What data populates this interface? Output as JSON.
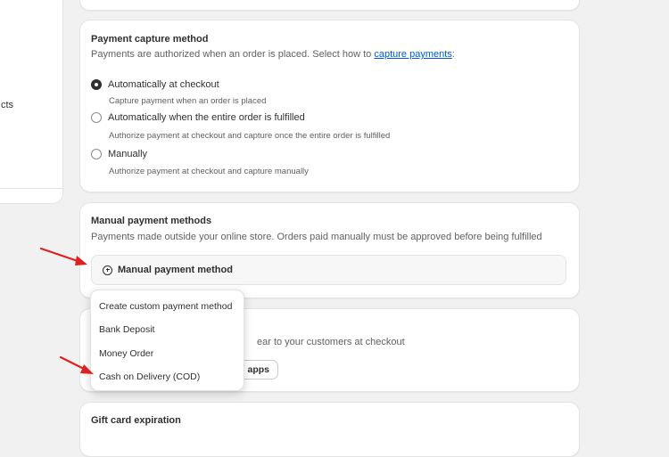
{
  "sidebar_fragment": {
    "text": "cts"
  },
  "capture": {
    "title": "Payment capture method",
    "desc_prefix": "Payments are authorized when an order is placed. Select how to ",
    "desc_link": "capture payments",
    "desc_suffix": ":",
    "options": [
      {
        "label": "Automatically at checkout",
        "help": "Capture payment when an order is placed",
        "selected": true
      },
      {
        "label": "Automatically when the entire order is fulfilled",
        "help": "Authorize payment at checkout and capture once the entire order is fulfilled",
        "selected": false
      },
      {
        "label": "Manually",
        "help": "Authorize payment at checkout and capture manually",
        "selected": false
      }
    ]
  },
  "manual": {
    "title": "Manual payment methods",
    "desc": "Payments made outside your online store. Orders paid manually must be approved before being fulfilled",
    "button_label": "Manual payment method",
    "button_icon": "plus-circle-icon"
  },
  "additional": {
    "desc_partial": "ear to your customers at checkout",
    "button_partial": "n apps"
  },
  "dropdown": {
    "items": [
      "Create custom payment method",
      "Bank Deposit",
      "Money Order",
      "Cash on Delivery (COD)"
    ]
  },
  "gift": {
    "title": "Gift card expiration"
  },
  "colors": {
    "arrow": "#e02020",
    "link": "#005bd3",
    "selected_radio": "#303030"
  }
}
